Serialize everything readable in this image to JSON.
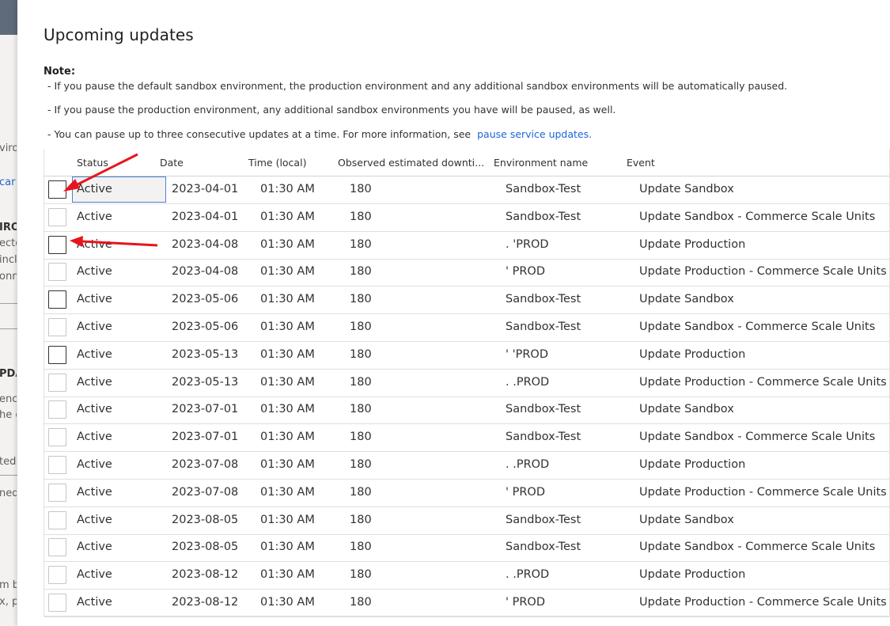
{
  "background": {
    "fragments": [
      "viro",
      "car",
      "IRO",
      "ecte",
      "incl",
      "onm",
      "PDA",
      "enc",
      "he c",
      "ted",
      "ned",
      "m b",
      "x, p"
    ]
  },
  "dialog": {
    "title": "Upcoming updates",
    "note_label": "Note:",
    "notes": [
      "- If you pause the default sandbox environment, the production environment and any additional sandbox environments will be automatically paused.",
      "- If you pause the production environment, any additional sandbox environments you have will be paused, as well.",
      "- You can pause up to three consecutive updates at a time. For more information, see"
    ],
    "link_text": "pause service updates."
  },
  "grid": {
    "columns": [
      "Status",
      "Date",
      "Time (local)",
      "Observed estimated downti...",
      "Environment name",
      "Event"
    ],
    "rows": [
      {
        "status": "Active",
        "date": "2023-04-01",
        "time": "01:30 AM",
        "downtime": "180",
        "env": "Sandbox-Test",
        "event": "Update Sandbox"
      },
      {
        "status": "Active",
        "date": "2023-04-01",
        "time": "01:30 AM",
        "downtime": "180",
        "env": "Sandbox-Test",
        "event": "Update Sandbox - Commerce Scale Units"
      },
      {
        "status": "Active",
        "date": "2023-04-08",
        "time": "01:30 AM",
        "downtime": "180",
        "env": ". 'PROD",
        "event": "Update Production"
      },
      {
        "status": "Active",
        "date": "2023-04-08",
        "time": "01:30 AM",
        "downtime": "180",
        "env": "' PROD",
        "event": "Update Production - Commerce Scale Units"
      },
      {
        "status": "Active",
        "date": "2023-05-06",
        "time": "01:30 AM",
        "downtime": "180",
        "env": "Sandbox-Test",
        "event": "Update Sandbox"
      },
      {
        "status": "Active",
        "date": "2023-05-06",
        "time": "01:30 AM",
        "downtime": "180",
        "env": "Sandbox-Test",
        "event": "Update Sandbox - Commerce Scale Units"
      },
      {
        "status": "Active",
        "date": "2023-05-13",
        "time": "01:30 AM",
        "downtime": "180",
        "env": "' 'PROD",
        "event": "Update Production"
      },
      {
        "status": "Active",
        "date": "2023-05-13",
        "time": "01:30 AM",
        "downtime": "180",
        "env": ". .PROD",
        "event": "Update Production - Commerce Scale Units"
      },
      {
        "status": "Active",
        "date": "2023-07-01",
        "time": "01:30 AM",
        "downtime": "180",
        "env": "Sandbox-Test",
        "event": "Update Sandbox"
      },
      {
        "status": "Active",
        "date": "2023-07-01",
        "time": "01:30 AM",
        "downtime": "180",
        "env": "Sandbox-Test",
        "event": "Update Sandbox - Commerce Scale Units"
      },
      {
        "status": "Active",
        "date": "2023-07-08",
        "time": "01:30 AM",
        "downtime": "180",
        "env": ". .PROD",
        "event": "Update Production"
      },
      {
        "status": "Active",
        "date": "2023-07-08",
        "time": "01:30 AM",
        "downtime": "180",
        "env": "' PROD",
        "event": "Update Production - Commerce Scale Units"
      },
      {
        "status": "Active",
        "date": "2023-08-05",
        "time": "01:30 AM",
        "downtime": "180",
        "env": "Sandbox-Test",
        "event": "Update Sandbox"
      },
      {
        "status": "Active",
        "date": "2023-08-05",
        "time": "01:30 AM",
        "downtime": "180",
        "env": "Sandbox-Test",
        "event": "Update Sandbox - Commerce Scale Units"
      },
      {
        "status": "Active",
        "date": "2023-08-12",
        "time": "01:30 AM",
        "downtime": "180",
        "env": ". .PROD",
        "event": "Update Production"
      },
      {
        "status": "Active",
        "date": "2023-08-12",
        "time": "01:30 AM",
        "downtime": "180",
        "env": "' PROD",
        "event": "Update Production - Commerce Scale Units"
      }
    ]
  },
  "colors": {
    "annotation_arrow": "#e8141c",
    "link": "#1a66d6",
    "focus_border": "#4a7fd6"
  }
}
